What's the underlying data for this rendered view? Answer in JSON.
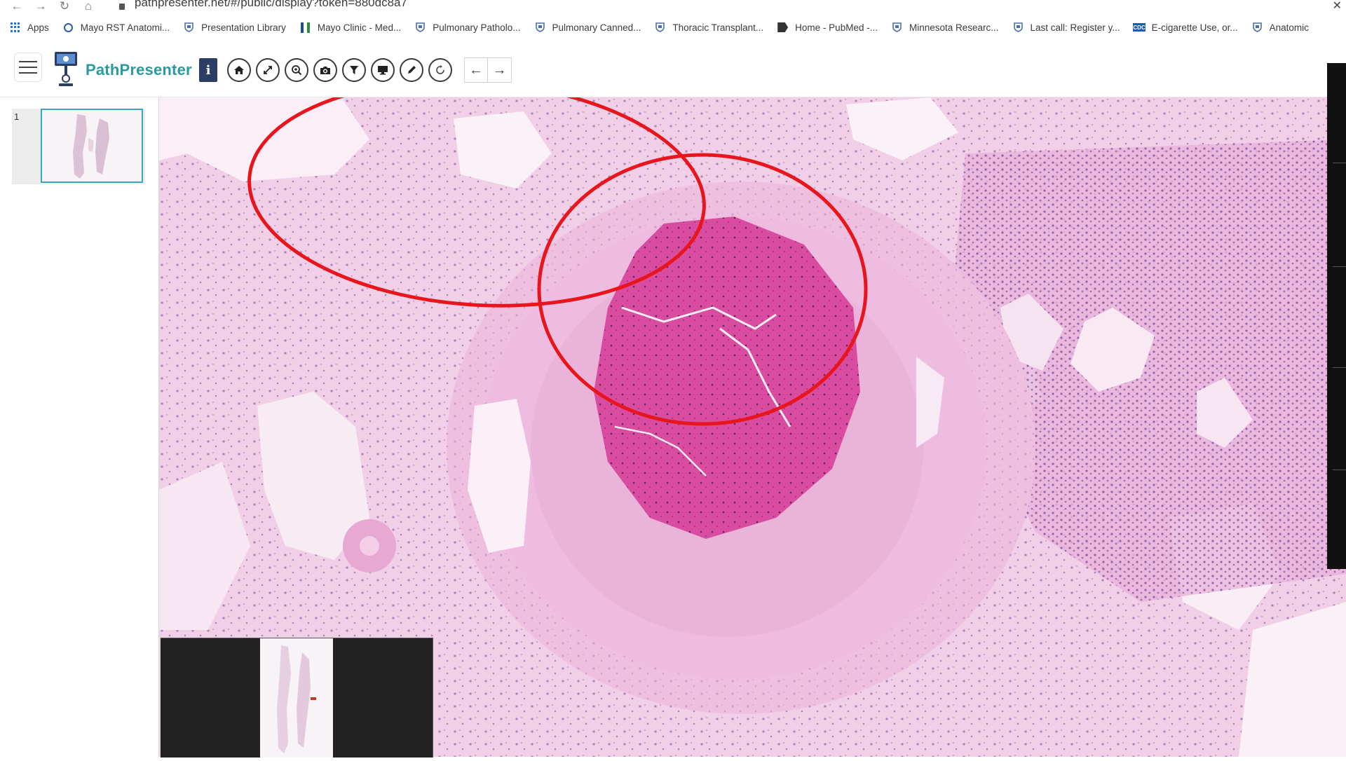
{
  "browser": {
    "url": "pathpresenter.net/#/public/display?token=880dc8a7",
    "bookmarks": [
      {
        "label": "Apps",
        "icon": "apps-grid-icon"
      },
      {
        "label": "Mayo RST Anatomi...",
        "icon": "globe-icon"
      },
      {
        "label": "Presentation Library",
        "icon": "shield-icon"
      },
      {
        "label": "Mayo Clinic - Med...",
        "icon": "mayo-icon"
      },
      {
        "label": "Pulmonary Patholo...",
        "icon": "shield-icon"
      },
      {
        "label": "Pulmonary Canned...",
        "icon": "shield-icon"
      },
      {
        "label": "Thoracic Transplant...",
        "icon": "shield-icon"
      },
      {
        "label": "Home - PubMed -...",
        "icon": "pubmed-icon"
      },
      {
        "label": "Minnesota Researc...",
        "icon": "shield-icon"
      },
      {
        "label": "Last call: Register y...",
        "icon": "shield-icon"
      },
      {
        "label": "E-cigarette Use, or...",
        "icon": "cdc-icon"
      },
      {
        "label": "Anatomic",
        "icon": "shield-icon"
      }
    ]
  },
  "app": {
    "name": "PathPresenter",
    "info_label": "i",
    "toolbar": [
      {
        "name": "home",
        "icon": "home-icon"
      },
      {
        "name": "fullscreen",
        "icon": "expand-icon"
      },
      {
        "name": "zoom",
        "icon": "zoom-icon"
      },
      {
        "name": "screenshot",
        "icon": "camera-icon"
      },
      {
        "name": "filter",
        "icon": "filter-icon"
      },
      {
        "name": "present",
        "icon": "monitor-icon"
      },
      {
        "name": "annotate",
        "icon": "pencil-icon"
      },
      {
        "name": "rotate",
        "icon": "rotate-icon"
      }
    ],
    "nav": {
      "prev": "←",
      "next": "→"
    }
  },
  "sidebar": {
    "slides": [
      {
        "number": "1"
      }
    ]
  },
  "annotations": {
    "color": "#e8161c",
    "count": 2
  },
  "colors": {
    "brand": "#2a9aa0",
    "info_button": "#2c3e66",
    "thumbnail_border": "#3aa8c2"
  }
}
